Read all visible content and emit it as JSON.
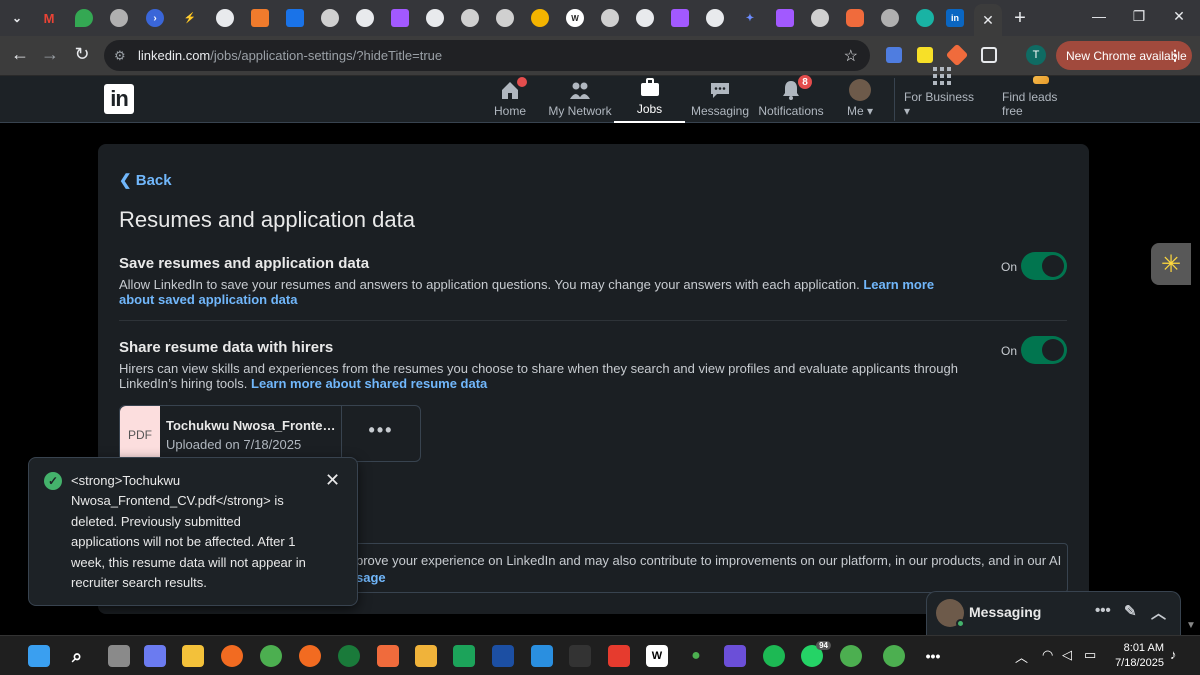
{
  "browser": {
    "url_host": "linkedin.com",
    "url_path": "/jobs/application-settings/?hideTitle=true",
    "update_label": "New Chrome available",
    "profile_initial": "T",
    "tab_close": "✕",
    "new_tab": "+"
  },
  "nav": {
    "logo": "in",
    "items": [
      {
        "label": "Home",
        "icon": "home-icon"
      },
      {
        "label": "My Network",
        "icon": "network-icon"
      },
      {
        "label": "Jobs",
        "icon": "briefcase-icon"
      },
      {
        "label": "Messaging",
        "icon": "chat-icon"
      },
      {
        "label": "Notifications",
        "icon": "bell-icon",
        "badge": "8"
      },
      {
        "label": "Me",
        "icon": "avatar"
      },
      {
        "label": "For Business",
        "icon": "grid-icon"
      },
      {
        "label": "Find leads free",
        "icon": "leads-icon"
      }
    ]
  },
  "page": {
    "back": "Back",
    "title": "Resumes and application data",
    "settings": [
      {
        "title": "Save resumes and application data",
        "desc": "Allow LinkedIn to save your resumes and answers to application questions. You may change your answers with each application.",
        "link": "Learn more about saved application data",
        "state": "On"
      },
      {
        "title": "Share resume data with hirers",
        "desc": "Hirers can view skills and experiences from the resumes you choose to share when they search and view profiles and evaluate applicants through LinkedIn’s hiring tools.",
        "link": "Learn more about shared resume data",
        "state": "On"
      }
    ],
    "resume": {
      "type": "PDF",
      "name": "Tochukwu Nwosa_Frontend...",
      "uploaded": "Uploaded on 7/18/2025",
      "more": "•••"
    },
    "info_text": "prove your experience on LinkedIn and may also contribute to improvements on our platform, in our products, and in our AI",
    "info_link": "sage"
  },
  "toast": {
    "message": "<strong>Tochukwu Nwosa_Frontend_CV.pdf</strong> is deleted. Previously submitted applications will not be affected. After 1 week, this resume data will not appear in recruiter search results.",
    "close": "✕"
  },
  "messaging": {
    "label": "Messaging"
  },
  "taskbar": {
    "time": "8:01 AM",
    "date": "7/18/2025",
    "badge_whatsapp": "94"
  },
  "colors": {
    "accent_link": "#71b7fb",
    "toggle_on": "#01754f",
    "card_bg": "#1b1f23",
    "chrome_update": "#a14a3d"
  }
}
